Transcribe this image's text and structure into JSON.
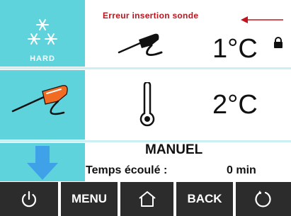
{
  "mode_panel": {
    "label": "HARD",
    "icon": "snowflakes-icon"
  },
  "error": {
    "message": "Erreur insertion sonde"
  },
  "probe_row": {
    "temperature": "1°C",
    "icon": "probe-icon",
    "locked": true
  },
  "thermo_row": {
    "temperature": "2°C",
    "icon": "thermometer-icon"
  },
  "status": {
    "mode": "MANUEL",
    "elapsed_label": "Temps écoulé :",
    "elapsed_value": "0 min"
  },
  "toolbar": {
    "power": "power-icon",
    "menu_label": "MENU",
    "home": "home-icon",
    "back_label": "BACK",
    "restart": "restart-icon"
  },
  "colors": {
    "panel_cyan": "#5fd3dc",
    "probe_orange": "#f26b22",
    "arrow_blue": "#3fa2e8",
    "error_red": "#c0131c",
    "toolbar_dark": "#2c2c2c"
  }
}
